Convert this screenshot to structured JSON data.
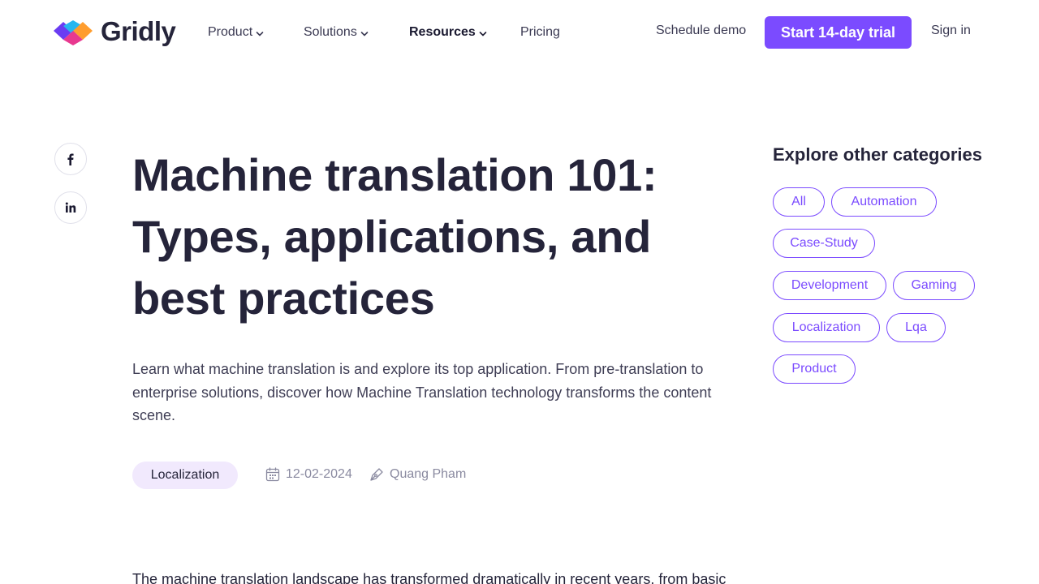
{
  "brand": {
    "name": "Gridly",
    "accent": "#7b4bff"
  },
  "nav": {
    "items": [
      {
        "label": "Product",
        "has_dropdown": true
      },
      {
        "label": "Solutions",
        "has_dropdown": true
      },
      {
        "label": "Resources",
        "has_dropdown": true,
        "active": true
      },
      {
        "label": "Pricing",
        "has_dropdown": false
      }
    ],
    "schedule_demo": "Schedule demo",
    "trial_button": "Start 14-day trial",
    "sign_in": "Sign in"
  },
  "social": {
    "icons": [
      "facebook-icon",
      "linkedin-icon"
    ]
  },
  "article": {
    "title": "Machine translation 101: Types, applications, and best practices",
    "lead": "Learn what machine translation is and explore its top application. From pre-translation to enterprise solutions, discover how Machine Translation technology transforms the content scene.",
    "tag": "Localization",
    "date": "12-02-2024",
    "author": "Quang Pham",
    "body_start": "The machine translation landscape has transformed dramatically in recent years, from basic"
  },
  "sidebar": {
    "title": "Explore other categories",
    "categories": [
      "All",
      "Automation",
      "Case-Study",
      "Development",
      "Gaming",
      "Localization",
      "Lqa",
      "Product"
    ]
  }
}
